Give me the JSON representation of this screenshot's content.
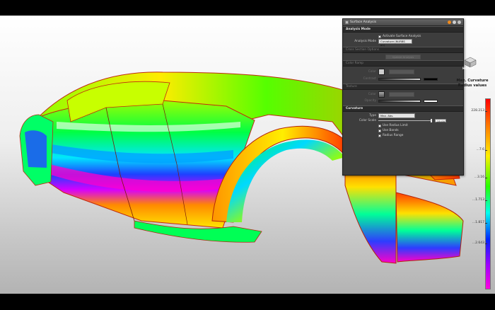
{
  "panel": {
    "title": "Surface Analysis",
    "sections": {
      "analysis_mode": "Analysis Mode",
      "cut_lines": "Cross Section Options",
      "color_ramp": "Color Ramp",
      "texture": "Texture",
      "curvature": "Curvature"
    },
    "activate_label": "Activate Surface Analysis",
    "analysis_mode_label": "Analysis Mode",
    "analysis_mode_value": "Curvature (NURBS on)",
    "disabled_button": "Update Analysis",
    "color_label": "Color",
    "contrast_label": "Contrast",
    "opacity_label": "Opacity",
    "type_label": "Type",
    "type_value": "Max. Abs.",
    "color_scale_label": "Color Scale",
    "color_scale_value": "25.00",
    "use_radius_limit": "Use Radius Limit",
    "use_bands": "Use Bands",
    "radius_range": "Radius Range"
  },
  "colorbar": {
    "title_line1": "Max. Curvature",
    "title_line2": "Radius values",
    "ticks": [
      "228.213",
      "...7.6",
      "...3.16",
      "...1.713",
      "...1.817",
      "...2.643"
    ],
    "colors": [
      "#ff0000",
      "#ff7a00",
      "#fff000",
      "#26ff00",
      "#00ffee",
      "#0024ff",
      "#9b00ff",
      "#ff00e0"
    ]
  },
  "nav": {
    "home_label": "HOME"
  }
}
